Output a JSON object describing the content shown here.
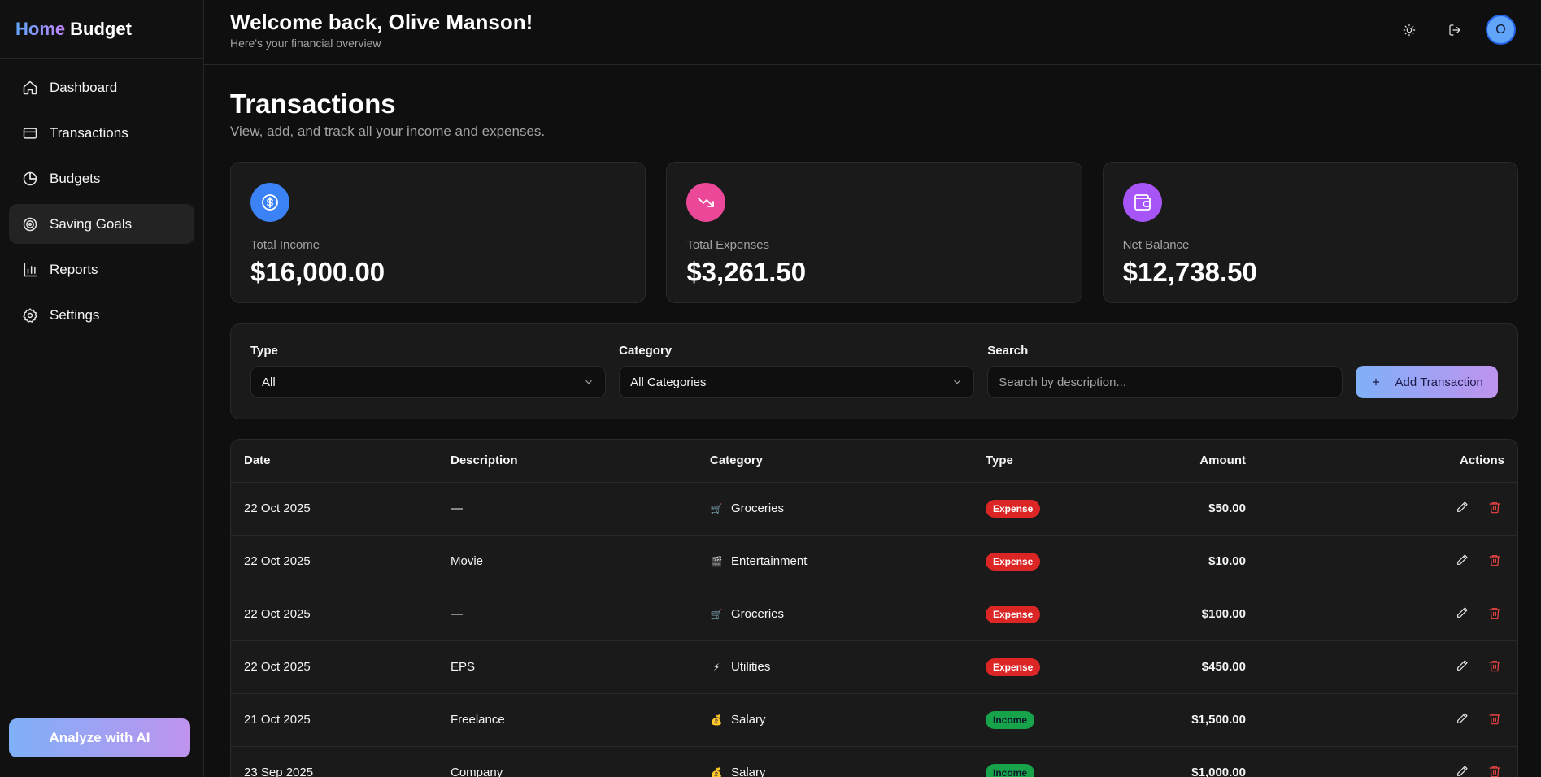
{
  "brand": {
    "part1": "Home",
    "part2": "Budget"
  },
  "sidebar": {
    "items": [
      {
        "label": "Dashboard",
        "icon": "home-icon"
      },
      {
        "label": "Transactions",
        "icon": "credit-card-icon"
      },
      {
        "label": "Budgets",
        "icon": "pie-chart-icon"
      },
      {
        "label": "Saving Goals",
        "icon": "target-icon",
        "active": true
      },
      {
        "label": "Reports",
        "icon": "bar-chart-icon"
      },
      {
        "label": "Settings",
        "icon": "gear-icon"
      }
    ],
    "ai_button": "Analyze with AI"
  },
  "header": {
    "welcome": "Welcome back, Olive Manson!",
    "subtitle": "Here's your financial overview",
    "avatar_initial": "O"
  },
  "page": {
    "title": "Transactions",
    "subtitle": "View, add, and track all your income and expenses."
  },
  "stats": [
    {
      "label": "Total Income",
      "value": "$16,000.00",
      "icon": "dollar-circle-icon",
      "color": "#3b82f6"
    },
    {
      "label": "Total Expenses",
      "value": "$3,261.50",
      "icon": "trending-down-icon",
      "color": "#ec4899"
    },
    {
      "label": "Net Balance",
      "value": "$12,738.50",
      "icon": "wallet-icon",
      "color": "#a855f7"
    }
  ],
  "filters": {
    "type_label": "Type",
    "type_value": "All",
    "category_label": "Category",
    "category_value": "All Categories",
    "search_label": "Search",
    "search_placeholder": "Search by description...",
    "add_button": "Add Transaction"
  },
  "table": {
    "headers": [
      "Date",
      "Description",
      "Category",
      "Type",
      "Amount",
      "Actions"
    ],
    "rows": [
      {
        "date": "22 Oct 2025",
        "description": "—",
        "category": "Groceries",
        "emoji": "🛒",
        "type": "Expense",
        "amount": "$50.00"
      },
      {
        "date": "22 Oct 2025",
        "description": "Movie",
        "category": "Entertainment",
        "emoji": "🎬",
        "type": "Expense",
        "amount": "$10.00"
      },
      {
        "date": "22 Oct 2025",
        "description": "—",
        "category": "Groceries",
        "emoji": "🛒",
        "type": "Expense",
        "amount": "$100.00"
      },
      {
        "date": "22 Oct 2025",
        "description": "EPS",
        "category": "Utilities",
        "emoji": "⚡",
        "type": "Expense",
        "amount": "$450.00"
      },
      {
        "date": "21 Oct 2025",
        "description": "Freelance",
        "category": "Salary",
        "emoji": "💰",
        "type": "Income",
        "amount": "$1,500.00"
      },
      {
        "date": "23 Sep 2025",
        "description": "Company",
        "category": "Salary",
        "emoji": "💰",
        "type": "Income",
        "amount": "$1,000.00"
      }
    ]
  }
}
